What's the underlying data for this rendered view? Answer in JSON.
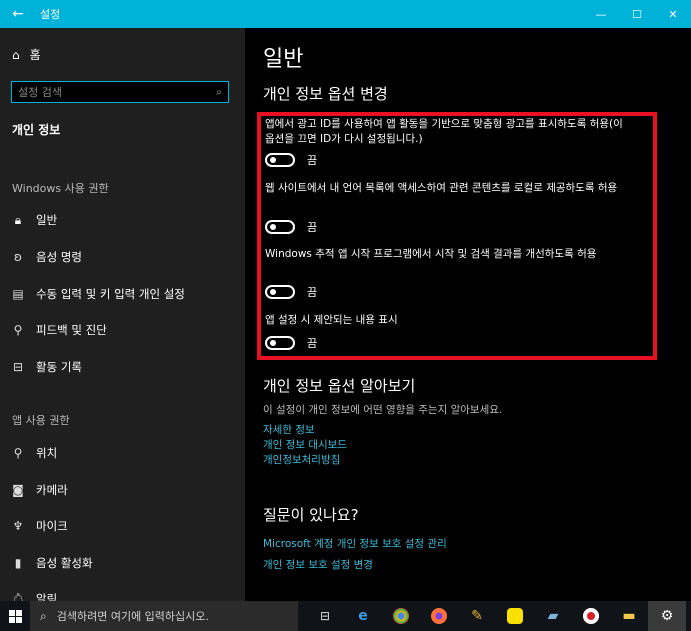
{
  "window": {
    "title": "설정",
    "controls": [
      "—",
      "☐",
      "✕"
    ]
  },
  "sidebar": {
    "home_label": "홈",
    "search_placeholder": "설정 검색",
    "privacy_label": "개인 정보",
    "windows_section": "Windows 사용 권한",
    "windows_items": [
      {
        "label": "일반",
        "icon": "lock-icon"
      },
      {
        "label": "음성 명령",
        "icon": "speech-icon"
      },
      {
        "label": "수동 입력 및 키 입력 개인 설정",
        "icon": "clipboard-icon"
      },
      {
        "label": "피드백 및 진단",
        "icon": "feedback-icon"
      },
      {
        "label": "활동 기록",
        "icon": "timeline-icon"
      }
    ],
    "app_section": "앱 사용 권한",
    "app_items": [
      {
        "label": "위치",
        "icon": "location-icon"
      },
      {
        "label": "카메라",
        "icon": "camera-icon"
      },
      {
        "label": "마이크",
        "icon": "microphone-icon"
      },
      {
        "label": "음성 활성화",
        "icon": "voice-icon"
      },
      {
        "label": "알림",
        "icon": "bell-icon"
      }
    ]
  },
  "main": {
    "title": "일반",
    "options_heading": "개인 정보 옵션 변경",
    "options": [
      {
        "text": "앱에서 광고 ID를 사용하여 앱 활동을 기반으로 맞춤형 광고를 표시하도록 허용(이 옵션을 끄면 ID가 다시 설정됩니다.)",
        "state": "끔",
        "on": false
      },
      {
        "text": "웹 사이트에서 내 언어 목록에 액세스하여 관련 콘텐츠를 로컬로 제공하도록 허용",
        "state": "끔",
        "on": false
      },
      {
        "text": "Windows 추적 앱 시작 프로그램에서 시작 및 검색 결과를 개선하도록 허용",
        "state": "끔",
        "on": false
      },
      {
        "text": "앱 설정 시 제안되는 내용 표시",
        "state": "끔",
        "on": false
      }
    ],
    "learn_heading": "개인 정보 옵션 알아보기",
    "learn_desc": "이 설정이 개인 정보에 어떤 영향을 주는지 알아보세요.",
    "learn_links": [
      "자세한 정보",
      "개인 정보 대시보드",
      "개인정보처리방침"
    ],
    "question_heading": "질문이 있나요?",
    "question_links": [
      "Microsoft 계정 개인 정보 보호 설정 관리",
      "개인 정보 보호 설정 변경"
    ]
  },
  "taskbar": {
    "search_placeholder": "검색하려면 여기에 입력하십시오."
  },
  "colors": {
    "accent": "#00b2d8",
    "highlight": "#e81123",
    "link": "#3bbcd9"
  }
}
